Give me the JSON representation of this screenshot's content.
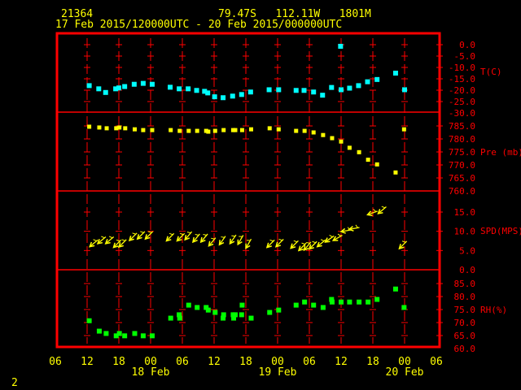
{
  "header": {
    "station_id": "21364",
    "location": "79.47S   112.11W   1801M",
    "period": "17 Feb 2015/120000UTC - 20 Feb 2015/000000UTC"
  },
  "page_number": "2",
  "colors": {
    "frame": "#ff0000",
    "text": "#ffff00",
    "temperature": "#00ffff",
    "pressure": "#ffff00",
    "wind": "#ffff00",
    "rh": "#00ff00"
  },
  "chart_data": {
    "type": "scatter",
    "title": "21364 79.47S 112.11W 1801M",
    "x_axis": {
      "unit": "hours since 17 Feb 2015 12UTC",
      "range": [
        -6,
        66
      ],
      "ticks": [
        -6,
        0,
        6,
        12,
        18,
        24,
        30,
        36,
        42,
        48,
        54,
        60,
        66
      ],
      "tick_labels": [
        "06",
        "12",
        "18",
        "00",
        "06",
        "12",
        "18",
        "00",
        "06",
        "12",
        "18",
        "00",
        "06"
      ],
      "day_labels": [
        {
          "hour": 12,
          "label": "18 Feb"
        },
        {
          "hour": 36,
          "label": "19 Feb"
        },
        {
          "hour": 60,
          "label": "20 Feb"
        }
      ]
    },
    "panels": [
      {
        "name": "temperature",
        "ylabel": "T(C)",
        "ylim": [
          -30,
          0
        ],
        "ticks": [
          0,
          -5,
          -10,
          -15,
          -20,
          -25,
          -30
        ],
        "tick_labels": [
          "0.0",
          "-5.0",
          "-10.0",
          "-15.0",
          "-20.0",
          "-25.0",
          "-30.0"
        ],
        "x": [
          0.4,
          2.2,
          3.5,
          5.4,
          6.0,
          7.1,
          8.9,
          10.6,
          12.3,
          15.7,
          17.4,
          19.1,
          20.7,
          22.2,
          22.8,
          24.1,
          25.7,
          27.5,
          29.2,
          30.9,
          34.4,
          36.2,
          39.5,
          41.0,
          42.8,
          44.5,
          46.2,
          47.9,
          48.0,
          49.6,
          51.3,
          53.0,
          54.8,
          58.3,
          60.0
        ],
        "y": [
          -18,
          -19.4,
          -21,
          -19.4,
          -19,
          -18.4,
          -17.4,
          -17,
          -17.4,
          -18.7,
          -19.4,
          -19.4,
          -20.1,
          -20.5,
          -21.2,
          -22.9,
          -23.3,
          -22.6,
          -21.9,
          -20.8,
          -19.8,
          -19.8,
          -20.1,
          -20.1,
          -20.8,
          -22.2,
          -18.8,
          -0.7,
          -19.8,
          -19.1,
          -18,
          -16.3,
          -15.3,
          -12.5,
          -19.8
        ]
      },
      {
        "name": "pressure",
        "ylabel": "Pre (mb)",
        "ylim": [
          760,
          787.5
        ],
        "ticks": [
          785,
          780,
          775,
          770,
          765,
          760
        ],
        "tick_labels": [
          "785.0",
          "780.0",
          "775.0",
          "770.0",
          "765.0",
          "760.0"
        ],
        "x": [
          0.4,
          2.3,
          3.7,
          5.5,
          6.1,
          7.2,
          9.0,
          10.6,
          12.3,
          15.8,
          17.5,
          19.2,
          20.8,
          22.5,
          22.9,
          24.2,
          25.8,
          27.6,
          28.0,
          29.3,
          31.0,
          34.5,
          36.2,
          39.5,
          41.1,
          42.8,
          44.6,
          46.3,
          48.0,
          49.6,
          51.4,
          53.1,
          54.8,
          58.3,
          59.9
        ],
        "y": [
          784.7,
          784.4,
          784.1,
          784.1,
          784.4,
          784.1,
          783.7,
          783.4,
          783.4,
          783.4,
          783.1,
          783.1,
          783.1,
          783.1,
          782.8,
          783.1,
          783.4,
          783.4,
          783.4,
          783.4,
          783.7,
          784.1,
          783.7,
          783.1,
          783.1,
          782.5,
          781.5,
          780.3,
          779.0,
          776.6,
          774.9,
          772.0,
          770.2,
          767.1,
          783.7
        ]
      },
      {
        "name": "wind_speed",
        "ylabel": "SPD(MPS)",
        "ylim": [
          0,
          20.5
        ],
        "ticks": [
          15,
          10,
          5,
          0
        ],
        "tick_labels": [
          "15.0",
          "10.0",
          "5.0",
          "0.0"
        ],
        "x": [
          0.5,
          2,
          3.5,
          5,
          6,
          8,
          9.5,
          11,
          15,
          17,
          18.5,
          20,
          21.5,
          23,
          25,
          27,
          28.5,
          30,
          34,
          35.7,
          38.5,
          40,
          41,
          42,
          43.5,
          45,
          46.5,
          48,
          49.5,
          53,
          55,
          59
        ],
        "y": [
          6.0,
          6.8,
          6.8,
          5.8,
          5.9,
          7.6,
          8.0,
          8.0,
          7.5,
          7.5,
          7.8,
          7.2,
          7.2,
          6.2,
          6.5,
          6.8,
          6.6,
          5.6,
          5.8,
          6.0,
          5.6,
          5.0,
          5.1,
          5.4,
          6.0,
          7.2,
          7.6,
          9.9,
          10.5,
          14.3,
          14.6,
          5.5
        ],
        "direction_deg": [
          50,
          50,
          50,
          45,
          45,
          45,
          45,
          45,
          45,
          45,
          40,
          40,
          40,
          40,
          35,
          35,
          30,
          30,
          45,
          45,
          45,
          45,
          40,
          45,
          50,
          55,
          60,
          80,
          80,
          70,
          50,
          45
        ]
      },
      {
        "name": "relative_humidity",
        "ylabel": "RH(%)",
        "ylim": [
          60,
          85
        ],
        "ticks": [
          85,
          80,
          75,
          70,
          65,
          60
        ],
        "tick_labels": [
          "85.0",
          "80.0",
          "75.0",
          "70.0",
          "65.0",
          "60.0"
        ],
        "x": [
          0.4,
          2.3,
          3.6,
          5.5,
          6.1,
          7.1,
          9.0,
          10.6,
          12.3,
          15.8,
          17.4,
          17.5,
          19.2,
          20.8,
          22.5,
          22.9,
          24.2,
          25.7,
          25.8,
          27.6,
          27.7,
          28.0,
          29.2,
          29.3,
          31.0,
          34.5,
          36.2,
          39.5,
          41.1,
          42.8,
          44.6,
          46.2,
          46.3,
          48.0,
          49.6,
          51.4,
          53.1,
          54.8,
          58.3,
          59.9
        ],
        "y": [
          70.7,
          66.7,
          65.8,
          64.9,
          65.8,
          64.9,
          65.8,
          64.9,
          64.9,
          71.7,
          73.0,
          71.7,
          76.7,
          75.8,
          75.8,
          74.8,
          73.9,
          71.7,
          73.0,
          73.0,
          71.7,
          73.0,
          73.0,
          76.7,
          71.7,
          73.9,
          74.8,
          76.7,
          77.9,
          76.7,
          75.8,
          78.9,
          77.9,
          77.9,
          77.9,
          77.9,
          77.9,
          78.9,
          82.9,
          75.8
        ]
      }
    ]
  }
}
